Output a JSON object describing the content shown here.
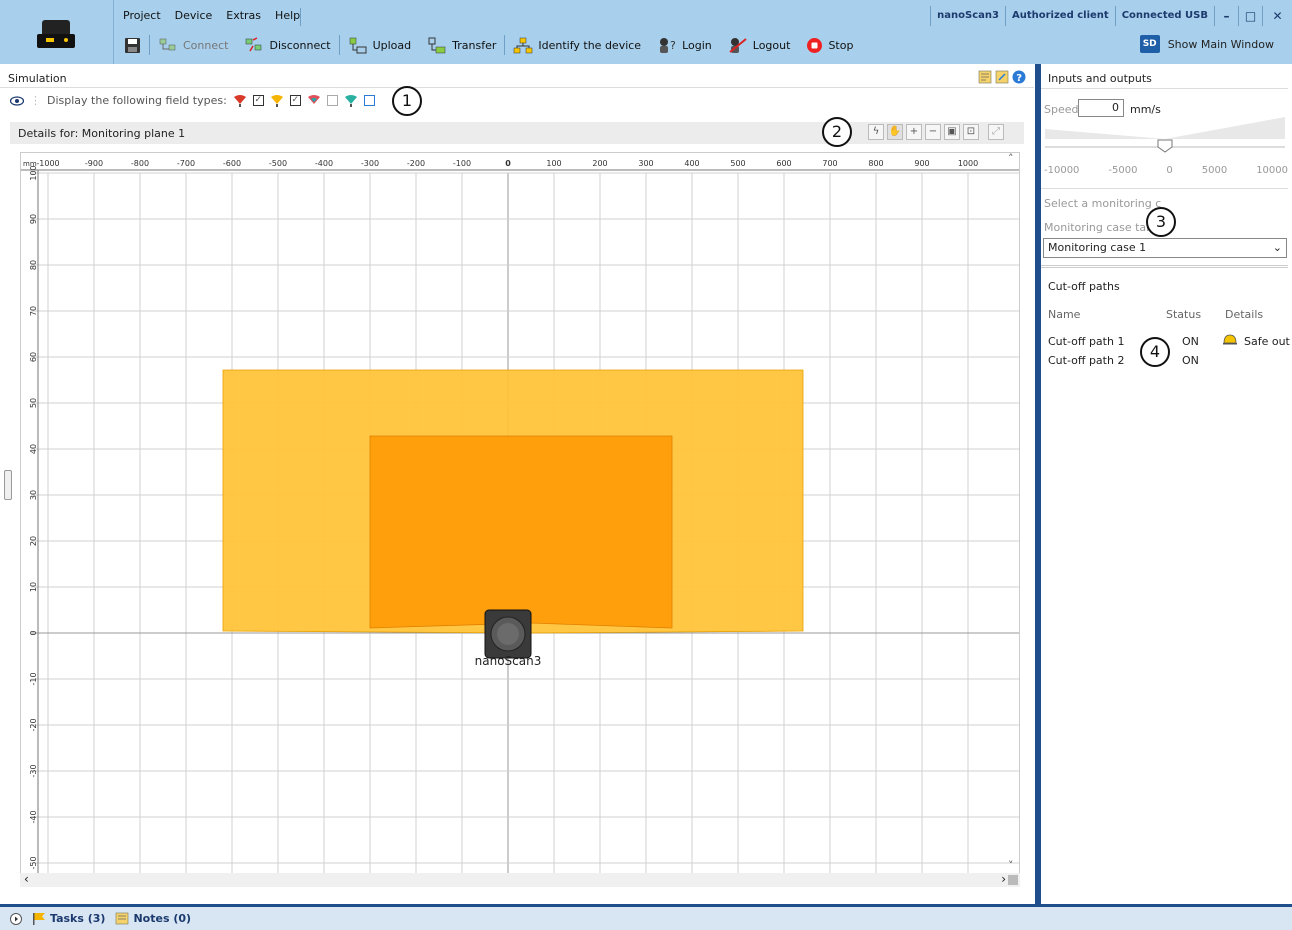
{
  "app": {
    "menu": [
      "Project",
      "Device",
      "Extras",
      "Help"
    ],
    "status": [
      "nanoScan3",
      "Authorized client",
      "Connected USB"
    ],
    "window_controls": {
      "minimize": "–",
      "maximize": "□",
      "close": "✕"
    }
  },
  "toolbar": {
    "connect": "Connect",
    "disconnect": "Disconnect",
    "upload": "Upload",
    "transfer": "Transfer",
    "identify": "Identify the device",
    "login": "Login",
    "logout": "Logout",
    "stop": "Stop",
    "show_main": "Show Main Window",
    "show_main_icon_text": "SD"
  },
  "simulation": {
    "title": "Simulation",
    "field_types_label": "Display the following field types:",
    "details_label": "Details for: Monitoring plane 1",
    "device_label": "nanoScan3",
    "unit": "mm",
    "x_ticks": [
      "-1000",
      "-900",
      "-800",
      "-700",
      "-600",
      "-500",
      "-400",
      "-300",
      "-200",
      "-100",
      "0",
      "100",
      "200",
      "300",
      "400",
      "500",
      "600",
      "700",
      "800",
      "900",
      "1000"
    ],
    "y_ticks": [
      "100",
      "90",
      "80",
      "70",
      "60",
      "50",
      "40",
      "30",
      "20",
      "10",
      "0",
      "-10",
      "-20",
      "-30",
      "-40",
      "-50"
    ]
  },
  "callouts": [
    "1",
    "2",
    "3",
    "4"
  ],
  "io": {
    "title": "Inputs and outputs",
    "speed_label": "Speed",
    "speed_value": "0",
    "speed_unit": "mm/s",
    "speed_ticks": [
      "-10000",
      "-5000",
      "0",
      "5000",
      "10000"
    ],
    "select_case_label": "Select a monitoring c",
    "case_table_label": "Monitoring case tab",
    "case_selected": "Monitoring case 1",
    "cutoff_title": "Cut-off paths",
    "col_name": "Name",
    "col_status": "Status",
    "col_details": "Details",
    "rows": [
      {
        "name": "Cut-off path 1",
        "status": "ON",
        "details": "Safe out"
      },
      {
        "name": "Cut-off path 2",
        "status": "ON",
        "details": ""
      }
    ]
  },
  "bottom": {
    "tasks": "Tasks (3)",
    "notes": "Notes (0)"
  },
  "colors": {
    "warning_field": "#ffc233",
    "protective_field": "#ff9d0a",
    "accent": "#1e4f8c",
    "toolbar_bg": "#a8d0ec"
  }
}
